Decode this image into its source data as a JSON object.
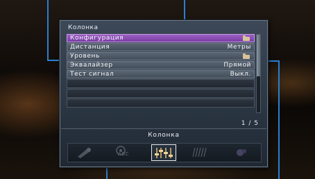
{
  "panel": {
    "title": "Колонка",
    "rows": [
      {
        "label": "Конфигурация",
        "value": "",
        "icon": "folder-icon",
        "selected": true
      },
      {
        "label": "Дистанция",
        "value": "Метры"
      },
      {
        "label": "Уровень",
        "value": "",
        "icon": "folder-icon"
      },
      {
        "label": "Эквалайзер",
        "value": "Прямой"
      },
      {
        "label": "Тест сигнал",
        "value": "Выкл."
      }
    ],
    "page_indicator": "1 / 5",
    "category_label": "Колонка",
    "icon_bar": {
      "items": [
        "input-icon",
        "sound-program-abc-icon",
        "speaker-equalizer-icon",
        "display-bars-icon",
        "function-icon"
      ],
      "abc_text": "ABC",
      "active_index": 2
    }
  },
  "colors": {
    "selected_row": "#8a4db5",
    "callout_lines": "#2a7fd0"
  }
}
